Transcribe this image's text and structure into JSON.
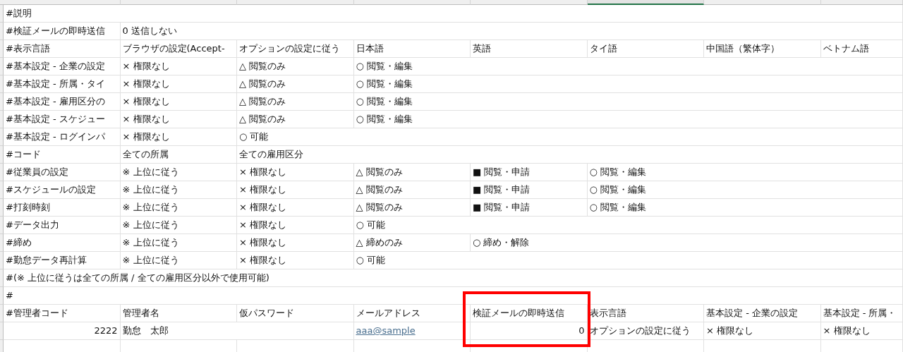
{
  "columns": [
    {
      "selected": false
    },
    {
      "selected": false
    },
    {
      "selected": false
    },
    {
      "selected": false
    },
    {
      "selected": false
    },
    {
      "selected": true
    },
    {
      "selected": false
    }
  ],
  "rows": [
    [
      {
        "text": "#説明",
        "kind": "text"
      },
      null,
      null,
      null,
      null,
      null,
      null,
      null
    ],
    [
      {
        "text": "#検証メールの即時送信",
        "kind": "text"
      },
      {
        "text": "0 送信しない",
        "kind": "text"
      },
      null,
      null,
      null,
      null,
      null,
      null
    ],
    [
      {
        "text": "#表示言語",
        "kind": "text"
      },
      {
        "text": "ブラウザの設定(Accept-",
        "kind": "text"
      },
      {
        "text": "オプションの設定に従う",
        "kind": "text"
      },
      {
        "text": "日本語",
        "kind": "text"
      },
      {
        "text": "英語",
        "kind": "text"
      },
      {
        "text": "タイ語",
        "kind": "text"
      },
      {
        "text": "中国語（繁体字）",
        "kind": "text"
      },
      {
        "text": "ベトナム語",
        "kind": "text"
      }
    ],
    [
      {
        "text": "#基本設定 - 企業の設定",
        "kind": "text"
      },
      {
        "text": "× 権限なし",
        "kind": "text"
      },
      {
        "text": "△ 閲覧のみ",
        "kind": "text"
      },
      {
        "text": "○ 閲覧・編集",
        "kind": "text"
      },
      null,
      null,
      null,
      null
    ],
    [
      {
        "text": "#基本設定 - 所属・タイ",
        "kind": "text"
      },
      {
        "text": "× 権限なし",
        "kind": "text"
      },
      {
        "text": "△ 閲覧のみ",
        "kind": "text"
      },
      {
        "text": "○ 閲覧・編集",
        "kind": "text"
      },
      null,
      null,
      null,
      null
    ],
    [
      {
        "text": "#基本設定 - 雇用区分の",
        "kind": "text"
      },
      {
        "text": "× 権限なし",
        "kind": "text"
      },
      {
        "text": "△ 閲覧のみ",
        "kind": "text"
      },
      {
        "text": "○ 閲覧・編集",
        "kind": "text"
      },
      null,
      null,
      null,
      null
    ],
    [
      {
        "text": "#基本設定 - スケジュー",
        "kind": "text"
      },
      {
        "text": "× 権限なし",
        "kind": "text"
      },
      {
        "text": "△ 閲覧のみ",
        "kind": "text"
      },
      {
        "text": "○ 閲覧・編集",
        "kind": "text"
      },
      null,
      null,
      null,
      null
    ],
    [
      {
        "text": "#基本設定 - ログインパ",
        "kind": "text"
      },
      {
        "text": "× 権限なし",
        "kind": "text"
      },
      {
        "text": "○ 可能",
        "kind": "text"
      },
      null,
      null,
      null,
      null,
      null
    ],
    [
      {
        "text": "#コード",
        "kind": "text"
      },
      {
        "text": "全ての所属",
        "kind": "text"
      },
      {
        "text": "全ての雇用区分",
        "kind": "text"
      },
      null,
      null,
      null,
      null,
      null
    ],
    [
      {
        "text": "#従業員の設定",
        "kind": "text"
      },
      {
        "text": "※ 上位に従う",
        "kind": "text"
      },
      {
        "text": "× 権限なし",
        "kind": "text"
      },
      {
        "text": "△ 閲覧のみ",
        "kind": "text"
      },
      {
        "text": "■ 閲覧・申請",
        "kind": "text"
      },
      {
        "text": "○ 閲覧・編集",
        "kind": "text"
      },
      null,
      null
    ],
    [
      {
        "text": "#スケジュールの設定",
        "kind": "text"
      },
      {
        "text": "※ 上位に従う",
        "kind": "text"
      },
      {
        "text": "× 権限なし",
        "kind": "text"
      },
      {
        "text": "△ 閲覧のみ",
        "kind": "text"
      },
      {
        "text": "■ 閲覧・申請",
        "kind": "text"
      },
      {
        "text": "○ 閲覧・編集",
        "kind": "text"
      },
      null,
      null
    ],
    [
      {
        "text": "#打刻時刻",
        "kind": "text"
      },
      {
        "text": "※ 上位に従う",
        "kind": "text"
      },
      {
        "text": "× 権限なし",
        "kind": "text"
      },
      {
        "text": "△ 閲覧のみ",
        "kind": "text"
      },
      {
        "text": "■ 閲覧・申請",
        "kind": "text"
      },
      {
        "text": "○ 閲覧・編集",
        "kind": "text"
      },
      null,
      null
    ],
    [
      {
        "text": "#データ出力",
        "kind": "text"
      },
      {
        "text": "※ 上位に従う",
        "kind": "text"
      },
      {
        "text": "× 権限なし",
        "kind": "text"
      },
      {
        "text": "○ 可能",
        "kind": "text"
      },
      null,
      null,
      null,
      null
    ],
    [
      {
        "text": "#締め",
        "kind": "text"
      },
      {
        "text": "※ 上位に従う",
        "kind": "text"
      },
      {
        "text": "× 権限なし",
        "kind": "text"
      },
      {
        "text": "△ 締めのみ",
        "kind": "text"
      },
      {
        "text": "○ 締め・解除",
        "kind": "text"
      },
      null,
      null,
      null
    ],
    [
      {
        "text": "#勤怠データ再計算",
        "kind": "text"
      },
      {
        "text": "※ 上位に従う",
        "kind": "text"
      },
      {
        "text": "× 権限なし",
        "kind": "text"
      },
      {
        "text": "○ 可能",
        "kind": "text"
      },
      null,
      null,
      null,
      null
    ],
    [
      {
        "text": "#(※ 上位に従うは全ての所属 / 全ての雇用区分以外で使用可能)",
        "kind": "text"
      },
      null,
      null,
      null,
      null,
      null,
      null,
      null
    ],
    [
      {
        "text": "#",
        "kind": "text"
      },
      null,
      null,
      null,
      null,
      null,
      null,
      null
    ],
    [
      {
        "text": "#管理者コード",
        "kind": "text"
      },
      {
        "text": "管理者名",
        "kind": "text"
      },
      {
        "text": "仮パスワード",
        "kind": "text"
      },
      {
        "text": "メールアドレス",
        "kind": "text"
      },
      {
        "text": "検証メールの即時送信",
        "kind": "text",
        "framed": true
      },
      {
        "text": "表示言語",
        "kind": "text"
      },
      {
        "text": "基本設定 - 企業の設定",
        "kind": "text"
      },
      {
        "text": "基本設定 - 所属・",
        "kind": "text"
      }
    ],
    [
      {
        "text": "2222",
        "kind": "number"
      },
      {
        "text": "勤怠　太郎",
        "kind": "text"
      },
      null,
      {
        "text": "aaa@sample",
        "kind": "link"
      },
      {
        "text": "0",
        "kind": "number",
        "framed": true
      },
      {
        "text": "オプションの設定に従う",
        "kind": "text"
      },
      {
        "text": "× 権限なし",
        "kind": "text"
      },
      {
        "text": "× 権限なし",
        "kind": "text"
      }
    ],
    [
      null,
      null,
      null,
      null,
      null,
      null,
      null,
      null
    ]
  ]
}
